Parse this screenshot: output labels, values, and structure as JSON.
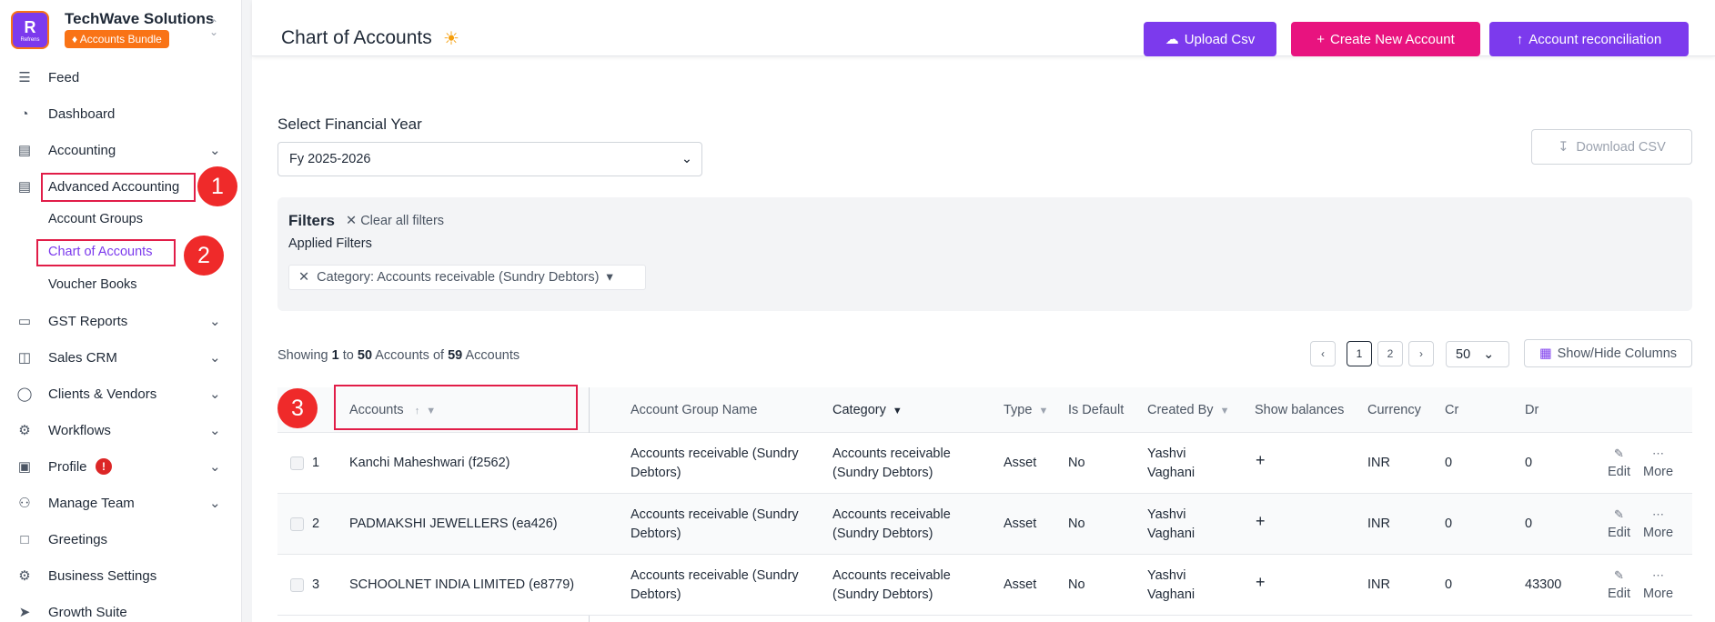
{
  "company": {
    "logo_text": "R",
    "logo_sub": "Refrens",
    "name": "TechWave Solutions",
    "plan": "Accounts Bundle"
  },
  "sidebar": {
    "items": [
      {
        "label": "Feed",
        "icon": "feed-icon"
      },
      {
        "label": "Dashboard",
        "icon": "dashboard-icon"
      },
      {
        "label": "Accounting",
        "icon": "accounting-icon",
        "expandable": true
      },
      {
        "label": "Advanced Accounting",
        "icon": "document-icon"
      },
      {
        "label": "GST Reports",
        "icon": "gst-icon",
        "expandable": true
      },
      {
        "label": "Sales CRM",
        "icon": "crm-icon",
        "expandable": true
      },
      {
        "label": "Clients & Vendors",
        "icon": "user-circle-icon",
        "expandable": true
      },
      {
        "label": "Workflows",
        "icon": "workflow-icon",
        "expandable": true
      },
      {
        "label": "Profile",
        "icon": "profile-icon",
        "expandable": true,
        "alert": "!"
      },
      {
        "label": "Manage Team",
        "icon": "team-icon",
        "expandable": true
      },
      {
        "label": "Greetings",
        "icon": "greetings-icon"
      },
      {
        "label": "Business Settings",
        "icon": "settings-icon"
      },
      {
        "label": "Growth Suite",
        "icon": "rocket-icon"
      }
    ],
    "sub_items": [
      {
        "label": "Account Groups"
      },
      {
        "label": "Chart of Accounts",
        "active": true
      },
      {
        "label": "Voucher Books"
      }
    ]
  },
  "annotations": [
    "1",
    "2",
    "3"
  ],
  "header": {
    "title": "Chart of Accounts",
    "buttons": {
      "upload": "Upload Csv",
      "create": "Create New Account",
      "reconcile": "Account reconciliation"
    }
  },
  "financial_year": {
    "label": "Select Financial Year",
    "value": "Fy 2025-2026"
  },
  "download_label": "Download CSV",
  "filters": {
    "title": "Filters",
    "clear_label": "Clear all filters",
    "applied_label": "Applied Filters",
    "chip": "Category: Accounts receivable (Sundry Debtors)"
  },
  "summary": {
    "prefix": "Showing",
    "from": "1",
    "to_word": "to",
    "to": "50",
    "accounts_word": "Accounts",
    "of_word": "of",
    "total": "59"
  },
  "pagination": {
    "pages": [
      "1",
      "2"
    ],
    "current": "1",
    "per_page": "50",
    "columns_label": "Show/Hide Columns"
  },
  "table": {
    "columns": [
      "Accounts",
      "Account Group Name",
      "Category",
      "Type",
      "Is Default",
      "Created By",
      "Show balances",
      "Currency",
      "Cr",
      "Dr"
    ],
    "actions": {
      "edit": "Edit",
      "more": "More"
    },
    "rows": [
      {
        "num": "1",
        "account": "Kanchi Maheshwari (f2562)",
        "group_1": "Accounts receivable (Sundry",
        "group_2": "Debtors)",
        "category_1": "Accounts receivable",
        "category_2": "(Sundry Debtors)",
        "type": "Asset",
        "default": "No",
        "created_1": "Yashvi",
        "created_2": "Vaghani",
        "balance": "+",
        "currency": "INR",
        "cr": "0",
        "dr": "0"
      },
      {
        "num": "2",
        "account": "PADMAKSHI JEWELLERS (ea426)",
        "group_1": "Accounts receivable (Sundry",
        "group_2": "Debtors)",
        "category_1": "Accounts receivable",
        "category_2": "(Sundry Debtors)",
        "type": "Asset",
        "default": "No",
        "created_1": "Yashvi",
        "created_2": "Vaghani",
        "balance": "+",
        "currency": "INR",
        "cr": "0",
        "dr": "0"
      },
      {
        "num": "3",
        "account": "SCHOOLNET INDIA LIMITED (e8779)",
        "group_1": "Accounts receivable (Sundry",
        "group_2": "Debtors)",
        "category_1": "Accounts receivable",
        "category_2": "(Sundry Debtors)",
        "type": "Asset",
        "default": "No",
        "created_1": "Yashvi",
        "created_2": "Vaghani",
        "balance": "+",
        "currency": "INR",
        "cr": "0",
        "dr": "43300"
      }
    ]
  },
  "colors": {
    "purple": "#7c3aed",
    "pink": "#e8137f",
    "orange": "#f97316",
    "annotation_red": "#ef2a2a"
  }
}
